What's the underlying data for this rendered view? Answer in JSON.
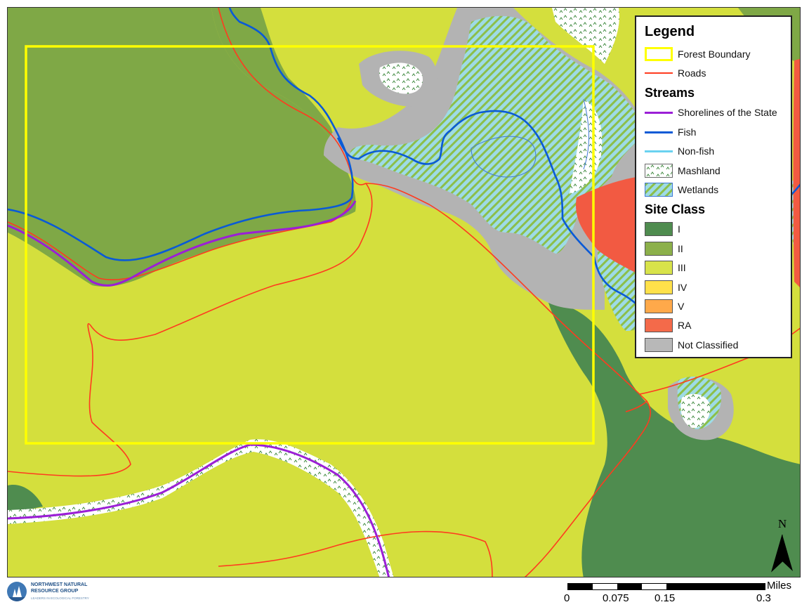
{
  "legend": {
    "title": "Legend",
    "general": [
      {
        "label": "Forest Boundary",
        "kind": "box",
        "color": "#ffff00"
      },
      {
        "label": "Roads",
        "kind": "line",
        "color": "#ff3b1f"
      }
    ],
    "streams_heading": "Streams",
    "streams": [
      {
        "label": "Shorelines of the State",
        "kind": "line",
        "color": "#9b1fd6"
      },
      {
        "label": "Fish",
        "kind": "line",
        "color": "#0a5ad6"
      },
      {
        "label": "Non-fish",
        "kind": "line",
        "color": "#6ad2f0"
      },
      {
        "label": "Mashland",
        "kind": "marsh"
      },
      {
        "label": "Wetlands",
        "kind": "wetland"
      }
    ],
    "site_class_heading": "Site Class",
    "site_classes": [
      {
        "label": "I",
        "color": "#4f8c4f"
      },
      {
        "label": "II",
        "color": "#8cb04a"
      },
      {
        "label": "III",
        "color": "#d8e34a"
      },
      {
        "label": "IV",
        "color": "#ffe14a"
      },
      {
        "label": "V",
        "color": "#ffa94a"
      },
      {
        "label": "RA",
        "color": "#f46a4a"
      },
      {
        "label": "Not Classified",
        "color": "#b8b8b8"
      }
    ]
  },
  "north_arrow": {
    "label": "N"
  },
  "scale_bar": {
    "units": "Miles",
    "ticks": [
      "0",
      "0.075",
      "0.15",
      "0.3"
    ]
  },
  "logo": {
    "line1": "NORTHWEST NATURAL",
    "line2": "RESOURCE GROUP",
    "line3": "LEADERS IN ECOLOGICAL FORESTRY"
  },
  "colors": {
    "site_I": "#4f8c4f",
    "site_II": "#7fa846",
    "site_III": "#d4df3d",
    "not_classified": "#b3b3b3",
    "ra": "#f25a42",
    "boundary": "#ffff00",
    "road": "#ff3b1f",
    "fish": "#0a5ad6",
    "shoreline": "#9b1fd6",
    "wetland_fill": "#9edbe6"
  }
}
